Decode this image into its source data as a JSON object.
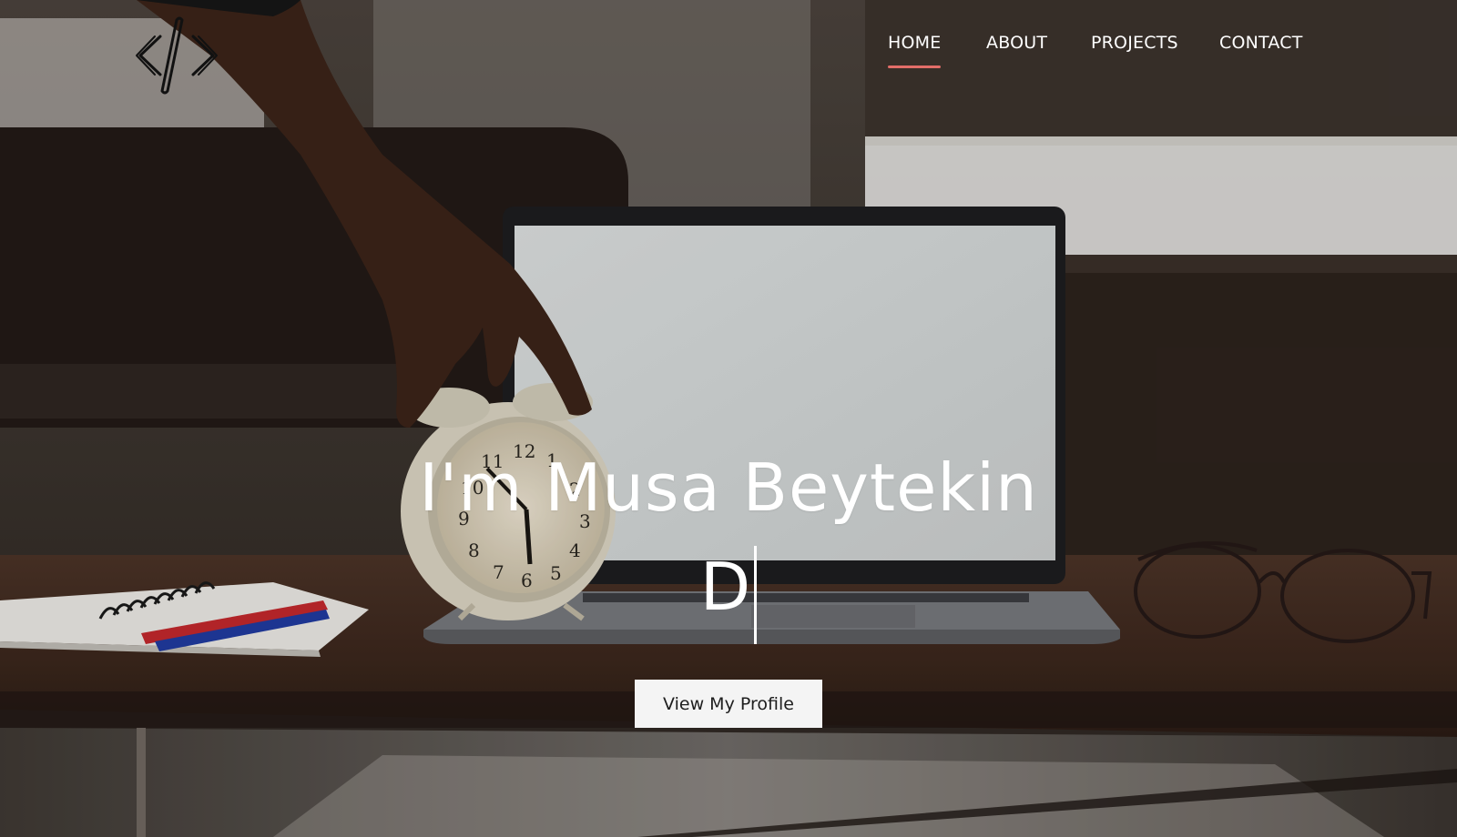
{
  "nav": {
    "items": [
      {
        "label": "HOME",
        "active": true
      },
      {
        "label": "ABOUT",
        "active": false
      },
      {
        "label": "PROJECTS",
        "active": false
      },
      {
        "label": "CONTACT",
        "active": false
      }
    ],
    "active_underline_color": "#e26d68"
  },
  "logo": {
    "icon": "code-brackets-icon"
  },
  "hero": {
    "headline": "I'm Musa Beytekin",
    "typed_text": "D",
    "cta_label": "View My Profile"
  }
}
